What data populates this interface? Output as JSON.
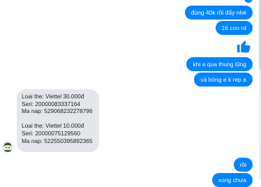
{
  "colors": {
    "outgoing": "#0084ff",
    "incoming": "#e4e6eb",
    "like": "#0084ff"
  },
  "outgoing_messages": [
    "đúng 40k rồi đấy nhé",
    "16 con rd",
    "khi a qua thung lũng",
    "và bóng e k rep a",
    "rồi",
    "xong chưa"
  ],
  "like_icon": "thumbs-up-icon",
  "incoming_message": {
    "lines": [
      "Loai the: Viettel 30.000đ",
      "Seri: 20000083337164",
      "Ma nap: 529068232278796",
      "Loai the: Viettel 10.000đ",
      "Seri: 20000075129560",
      "Ma nap: 522550395892365"
    ]
  },
  "avatar_icon": "contact-avatar"
}
